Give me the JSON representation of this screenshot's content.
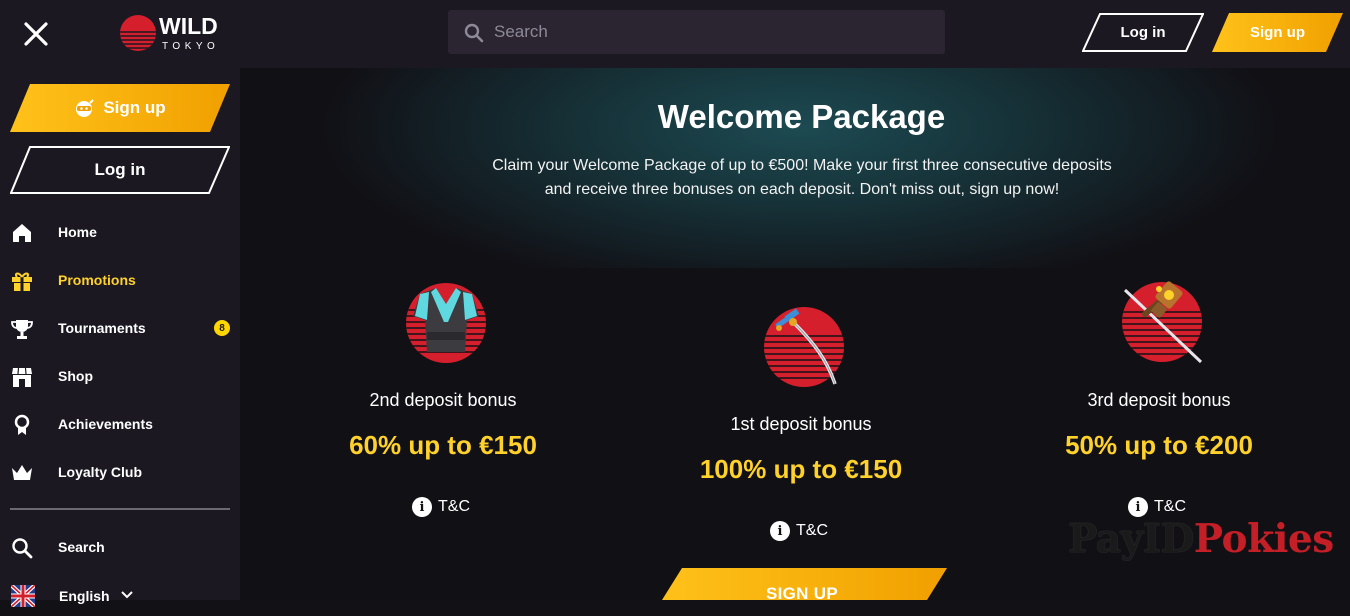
{
  "header": {
    "logo_top": "WILD",
    "logo_bottom": "TOKYO",
    "search_placeholder": "Search",
    "login_label": "Log in",
    "signup_label": "Sign up"
  },
  "sidebar": {
    "signup_label": "Sign up",
    "login_label": "Log in",
    "items": [
      {
        "label": "Home",
        "icon": "home-icon"
      },
      {
        "label": "Promotions",
        "icon": "gift-icon",
        "active": true
      },
      {
        "label": "Tournaments",
        "icon": "trophy-icon",
        "badge": "8"
      },
      {
        "label": "Shop",
        "icon": "shop-icon"
      },
      {
        "label": "Achievements",
        "icon": "medal-icon"
      },
      {
        "label": "Loyalty Club",
        "icon": "crown-icon"
      }
    ],
    "search_label": "Search",
    "language_label": "English"
  },
  "hero": {
    "title": "Welcome Package",
    "subtitle_line1": "Claim your Welcome Package of up to €500! Make your first three consecutive deposits",
    "subtitle_line2": "and receive three bonuses on each deposit. Don't miss out, sign up now!"
  },
  "bonuses": [
    {
      "title": "2nd deposit bonus",
      "amount": "60% up to €150",
      "tc": "T&C",
      "icon": "kimono-icon"
    },
    {
      "title": "1st deposit bonus",
      "amount": "100% up to €150",
      "tc": "T&C",
      "icon": "katana-icon"
    },
    {
      "title": "3rd deposit bonus",
      "amount": "50% up to €200",
      "tc": "T&C",
      "icon": "hammer-icon"
    }
  ],
  "cta_label": "SIGN UP",
  "watermark": {
    "part1": "PayID",
    "part2": "Pokies"
  },
  "colors": {
    "accent_yellow": "#ffd12b",
    "button_gradient_start": "#ffc21a",
    "button_gradient_end": "#f0a000",
    "sidebar_bg": "#1c1822",
    "main_bg": "#111015",
    "watermark_red": "#c41e26"
  },
  "info_glyph": "i"
}
